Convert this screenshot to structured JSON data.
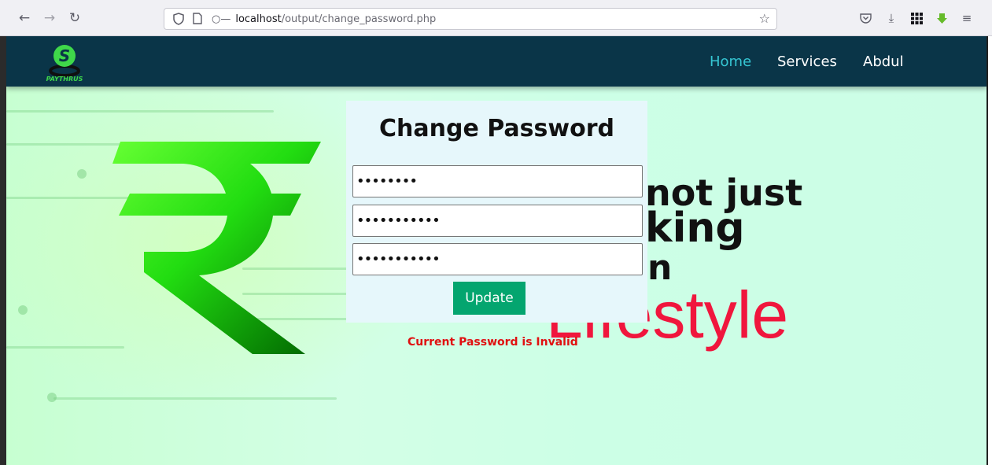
{
  "browser": {
    "url_host": "localhost",
    "url_path": "/output/change_password.php"
  },
  "navbar": {
    "logo_text": "PAYTHRUS",
    "links": [
      {
        "label": "Home",
        "active": true
      },
      {
        "label": "Services",
        "active": false
      },
      {
        "label": "Abdul",
        "active": false
      }
    ]
  },
  "hero": {
    "line1": "not just",
    "line2": "king",
    "line3": "n",
    "line4": "Lifestyle"
  },
  "form": {
    "title": "Change Password",
    "current_password_value": "••••••••",
    "new_password_value": "•••••••••••",
    "confirm_password_value": "•••••••••••",
    "submit_label": "Update",
    "error_message": "Current Password is Invalid"
  },
  "colors": {
    "navbar": "#0a3548",
    "active_link": "#35c6d3",
    "button": "#04a56f",
    "error": "#e01010",
    "hero_red": "#f0163d"
  }
}
